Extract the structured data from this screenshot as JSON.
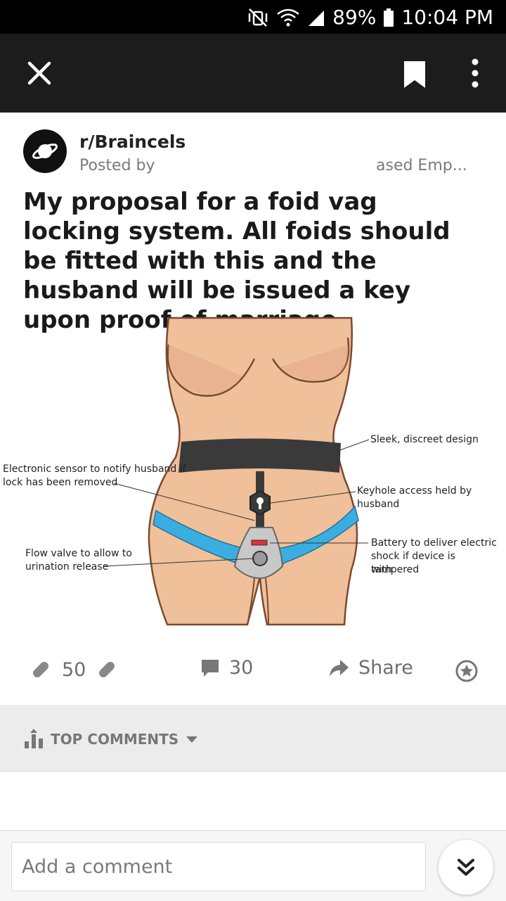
{
  "status_bar": {
    "battery": "89%",
    "time": "10:04 PM",
    "icons": [
      "mute-vibrate-icon",
      "wifi-icon",
      "signal-icon",
      "battery-icon"
    ]
  },
  "toolbar": {
    "icons": [
      "close-icon",
      "bookmark-icon",
      "more-options-icon"
    ]
  },
  "post": {
    "subreddit": "r/Braincels",
    "posted_by": "Posted by",
    "flair": "ased Emp...",
    "title": "My proposal for a foid vag locking system. All foids should be fitted with this and the husband will be issued a key upon proof of marriage.",
    "image_labels": {
      "sleek": "Sleek, discreet design",
      "sensor_line1": "Electronic sensor to notify husband if",
      "sensor_line2": "lock has been removed",
      "keyhole": "Keyhole access held by husband",
      "flow_line1": "Flow valve to allow to",
      "flow_line2": "urination release",
      "battery_line1": "Battery to deliver electric",
      "battery_line2": "shock if device is tampered",
      "battery_line3": "with"
    }
  },
  "actions": {
    "votes": "50",
    "comments": "30",
    "share": "Share"
  },
  "comments_header": {
    "label": "TOP COMMENTS"
  },
  "comment_input": {
    "placeholder": "Add a comment"
  },
  "colors": {
    "toolbar_bg": "#1c1c1c",
    "underwear_blue": "#3aaee0",
    "skin": "#efc09a",
    "belt": "#3a3a3a"
  }
}
